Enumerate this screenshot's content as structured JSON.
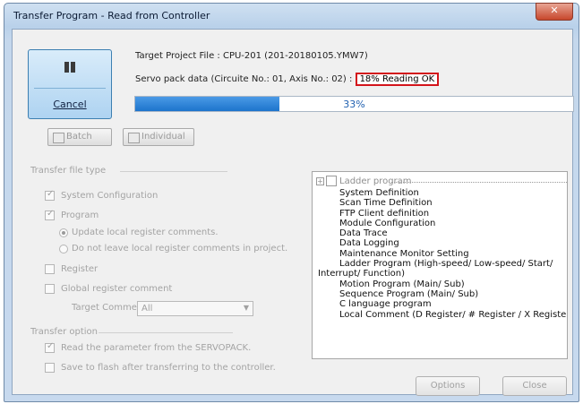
{
  "window": {
    "title": "Transfer Program - Read from Controller",
    "close_glyph": "✕"
  },
  "cancel_button": {
    "label": "Cancel",
    "icon": "pause-icon"
  },
  "info": {
    "target_project": "Target Project File : CPU-201     (201-20180105.YMW7)",
    "servo_prefix": "Servo pack data (Circuite No.: 01, Axis No.: 02) : ",
    "servo_status": "18% Reading OK"
  },
  "progress": {
    "text": "33%",
    "value": 0.33
  },
  "mode_buttons": {
    "batch": "Batch",
    "individual": "Individual"
  },
  "transfer_file_type": {
    "label": "Transfer file type",
    "system_configuration": "System Configuration",
    "program": "Program",
    "update_local": "Update local register comments.",
    "no_leave_local": "Do not leave local register comments in project.",
    "register": "Register",
    "global_register_comment": "Global register comment",
    "target_comment_label": "Target Comment",
    "target_comment_value": "All"
  },
  "transfer_option": {
    "label": "Transfer option",
    "read_param": "Read the parameter from the SERVOPACK.",
    "save_flash": "Save to flash after transferring to the controller."
  },
  "tree": {
    "root": "Ladder program",
    "items": [
      "System Definition",
      "Scan Time Definition",
      "FTP Client definition",
      "Module Configuration",
      "Data Trace",
      "Data Logging",
      "Maintenance Monitor Setting",
      "Ladder Program (High-speed/ Low-speed/ Start/",
      "Interrupt/ Function)",
      "Motion Program (Main/ Sub)",
      "Sequence Program (Main/ Sub)",
      "C language program",
      "Local Comment (D Register/ # Register / X Register / Y"
    ]
  },
  "footer": {
    "options": "Options",
    "close": "Close"
  }
}
